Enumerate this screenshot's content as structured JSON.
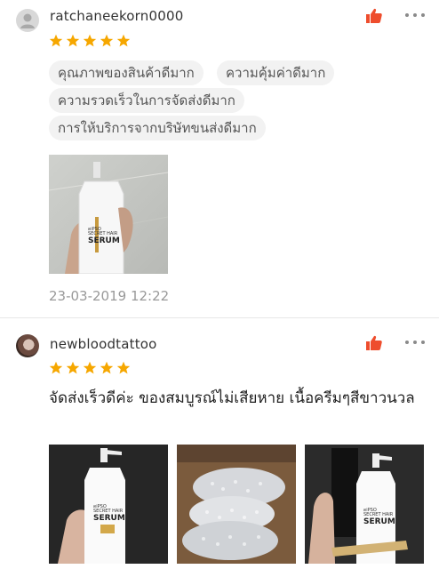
{
  "reviews": [
    {
      "username": "ratchaneekorn0000",
      "rating": 5,
      "avatar_icon": "default-user-icon",
      "tags": [
        "คุณภาพของสินค้าดีมาก",
        "ความคุ้มค่าดีมาก",
        "ความรวดเร็วในการจัดส่งดีมาก",
        "การให้บริการจากบริษัทขนส่งดีมาก"
      ],
      "photo_text": {
        "brand": "ดiPSO",
        "line1": "SECRET HAIR",
        "line2": "SERUM"
      },
      "timestamp": "23-03-2019 12:22"
    },
    {
      "username": "newbloodtattoo",
      "rating": 5,
      "comment": "จัดส่งเร็วดีค่ะ  ของสมบูรณ์ไม่เสียหาย เนื้อครีมๆสีขาวนวล",
      "photo_text": {
        "brand": "ดiPSO",
        "line1": "SECRET HAIR",
        "line2": "SERUM"
      }
    }
  ],
  "colors": {
    "star": "#f6a700",
    "like": "#ee4d2d",
    "tag_bg": "#f2f2f2",
    "muted_text": "#999999"
  }
}
